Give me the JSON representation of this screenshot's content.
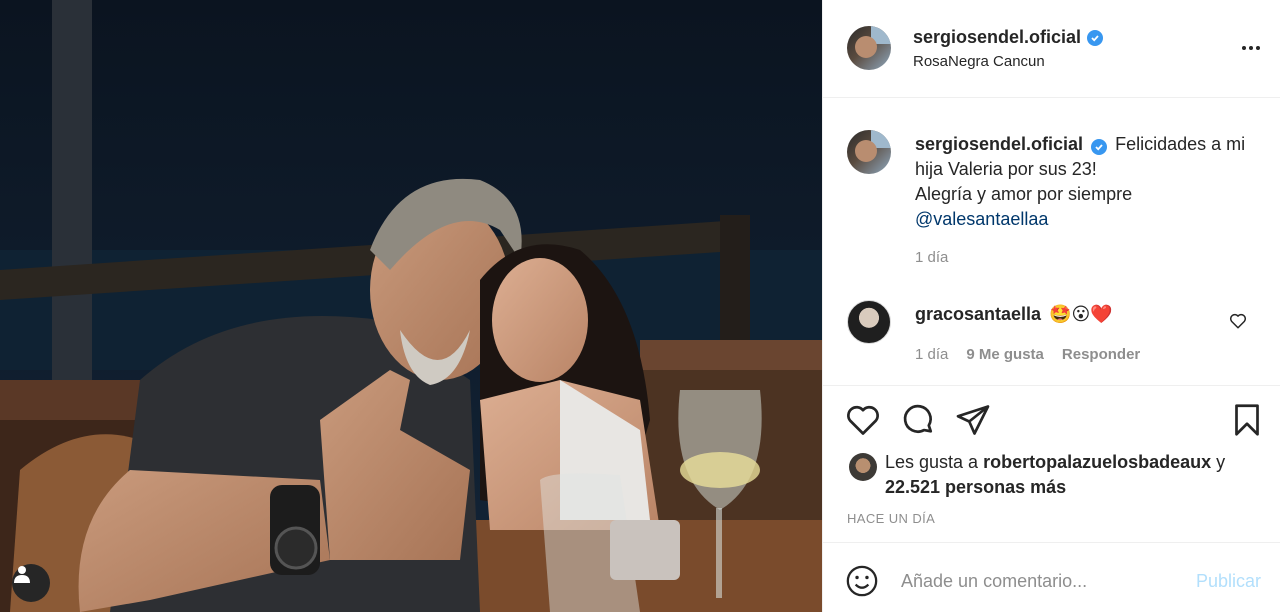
{
  "post": {
    "author": "sergiosendel.oficial",
    "location": "RosaNegra Cancun",
    "caption_lines": [
      "Felicidades a mi hija Valeria por sus 23!",
      "Alegría y amor por siempre"
    ],
    "caption_mention": "@valesantaellaa",
    "caption_time": "1 día",
    "posted_ago": "HACE UN DÍA"
  },
  "comment": {
    "user": "gracosantaella",
    "emojis": "🤩😮❤️",
    "time": "1 día",
    "likes": "9 Me gusta",
    "reply": "Responder"
  },
  "likes": {
    "prefix": "Les gusta a",
    "user": "robertopalazuelosbadeaux",
    "conjunction": "y",
    "count": "22.521 personas más"
  },
  "add_comment": {
    "placeholder": "Añade un comentario...",
    "publish": "Publicar"
  },
  "colors": {
    "verified": "#3897f0",
    "link": "#00376b",
    "muted": "#8e8e8e",
    "publish_disabled": "#b2dffc",
    "heart_emoji": "#ed4956"
  },
  "icons": [
    "verified-badge-icon",
    "more-options-icon",
    "heart-icon",
    "comment-icon",
    "share-icon",
    "save-icon",
    "emoji-icon",
    "user-tag-icon"
  ]
}
